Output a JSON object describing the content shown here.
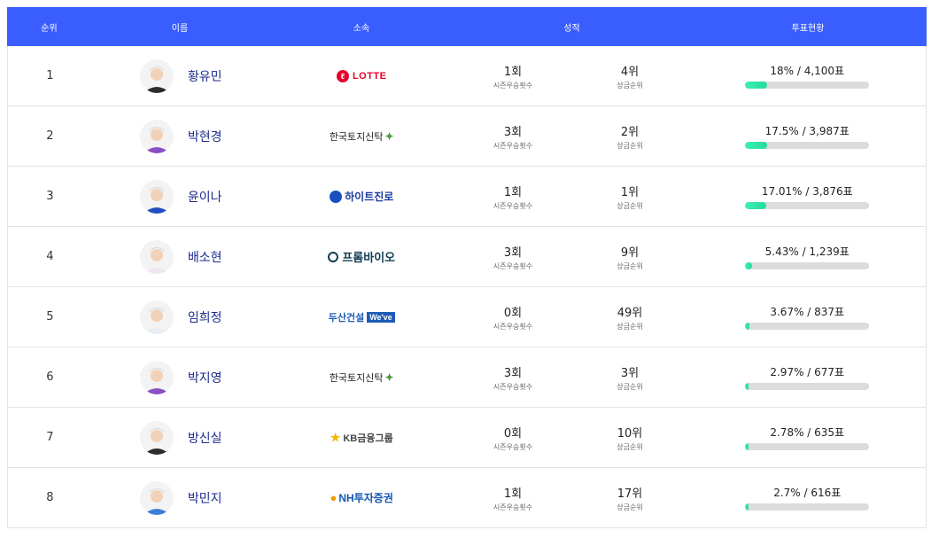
{
  "header": {
    "rank": "순위",
    "name": "이름",
    "affiliation": "소속",
    "performance": "성적",
    "votes": "투표현황"
  },
  "labels": {
    "season_wins": "시즌우승횟수",
    "prize_rank": "상금순위"
  },
  "colors": {
    "header_bg": "#3a5dff",
    "bar_fill": "#3ef0b2",
    "bar_track": "#dcdcdc",
    "name_color": "#1b2a8a"
  },
  "rows": [
    {
      "rank": "1",
      "name": "황유민",
      "sponsor": "LOTTE",
      "sponsor_icon": "lotte-logo",
      "wins": "1회",
      "prize_rank": "4위",
      "vote": "18% / 4,100표",
      "vote_pct": 18
    },
    {
      "rank": "2",
      "name": "박현경",
      "sponsor": "한국토지신탁",
      "sponsor_icon": "korea-land-trust-logo",
      "wins": "3회",
      "prize_rank": "2위",
      "vote": "17.5% / 3,987표",
      "vote_pct": 17.5
    },
    {
      "rank": "3",
      "name": "윤이나",
      "sponsor": "하이트진로",
      "sponsor_icon": "hite-jinro-logo",
      "wins": "1회",
      "prize_rank": "1위",
      "vote": "17.01% / 3,876표",
      "vote_pct": 17.01
    },
    {
      "rank": "4",
      "name": "배소현",
      "sponsor": "프롬바이오",
      "sponsor_icon": "frombio-logo",
      "wins": "3회",
      "prize_rank": "9위",
      "vote": "5.43% / 1,239표",
      "vote_pct": 5.43
    },
    {
      "rank": "5",
      "name": "임희정",
      "sponsor": "두산건설",
      "sponsor_badge": "We've",
      "sponsor_icon": "doosan-logo",
      "wins": "0회",
      "prize_rank": "49위",
      "vote": "3.67% / 837표",
      "vote_pct": 3.67
    },
    {
      "rank": "6",
      "name": "박지영",
      "sponsor": "한국토지신탁",
      "sponsor_icon": "korea-land-trust-logo",
      "wins": "3회",
      "prize_rank": "3위",
      "vote": "2.97% / 677표",
      "vote_pct": 2.97
    },
    {
      "rank": "7",
      "name": "방신실",
      "sponsor": "KB금융그룹",
      "sponsor_icon": "kb-logo",
      "wins": "0회",
      "prize_rank": "10위",
      "vote": "2.78% / 635표",
      "vote_pct": 2.78
    },
    {
      "rank": "8",
      "name": "박민지",
      "sponsor": "NH투자증권",
      "sponsor_icon": "nh-logo",
      "wins": "1회",
      "prize_rank": "17위",
      "vote": "2.7% / 616표",
      "vote_pct": 2.7
    }
  ]
}
